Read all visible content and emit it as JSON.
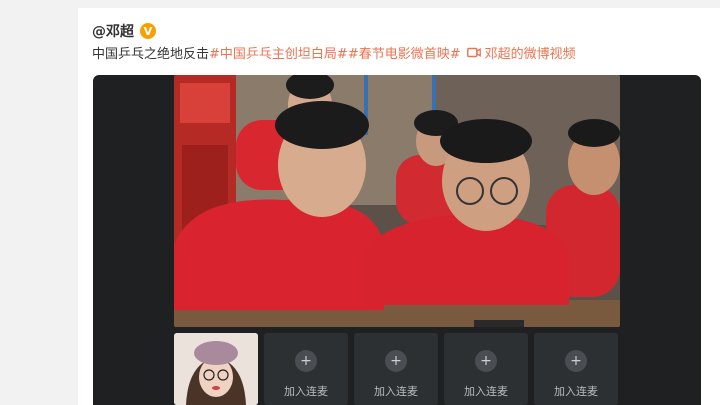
{
  "post": {
    "username": "@邓超",
    "verified_mark": "V",
    "text_prefix": "中国乒乓之绝地反击",
    "hashtags": [
      "#中国乒乓主创坦白局#",
      "#春节电影微首映#"
    ],
    "video_link": "邓超的微博视频"
  },
  "colors": {
    "link": "#eb7350",
    "verified": "#f7a000",
    "player_bg": "#1e2022",
    "hoodie_red": "#d9242f"
  },
  "player": {
    "slots": [
      {
        "label": "加入连麦",
        "icon": "plus-icon"
      },
      {
        "label": "加入连麦",
        "icon": "plus-icon"
      },
      {
        "label": "加入连麦",
        "icon": "plus-icon"
      },
      {
        "label": "加入连麦",
        "icon": "plus-icon"
      }
    ]
  }
}
